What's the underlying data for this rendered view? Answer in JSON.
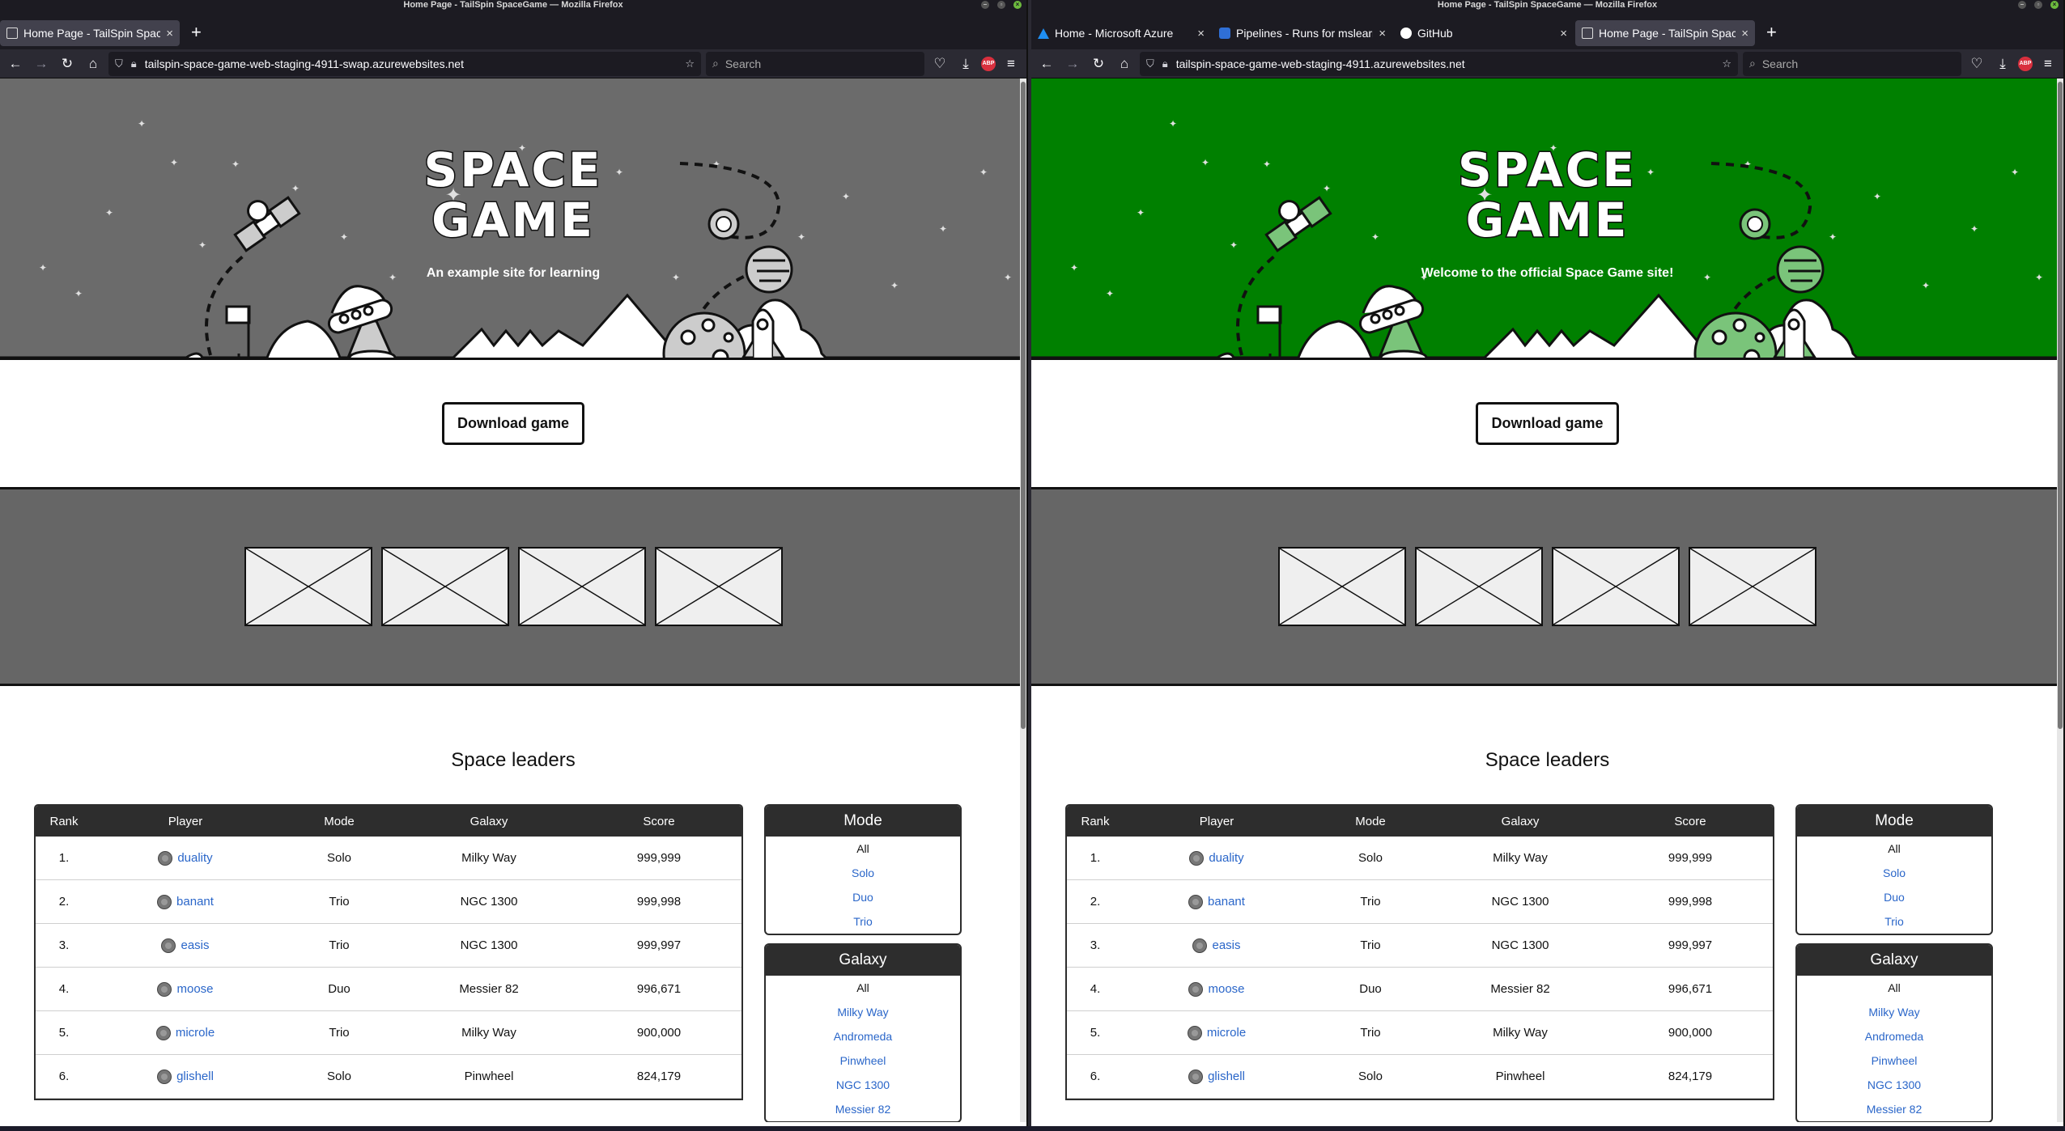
{
  "os": {
    "window_title": "Home Page - TailSpin SpaceGame — Mozilla Firefox"
  },
  "left": {
    "tabs": [
      {
        "label": "Home Page - TailSpin Space",
        "icon": "page-icon",
        "active": true
      }
    ],
    "url": "tailspin-space-game-web-staging-4911-swap.azurewebsites.net",
    "search_placeholder": "Search",
    "hero_color": "#6b6b6b",
    "hero_accent": "#cccccc",
    "subtitle": "An example site for learning"
  },
  "right": {
    "tabs": [
      {
        "label": "Home - Microsoft Azure",
        "icon": "azure-icon",
        "active": false
      },
      {
        "label": "Pipelines - Runs for mslearn",
        "icon": "pipelines-icon",
        "active": false
      },
      {
        "label": "GitHub",
        "icon": "github-icon",
        "active": false
      },
      {
        "label": "Home Page - TailSpin Space",
        "icon": "page-icon",
        "active": true
      }
    ],
    "url": "tailspin-space-game-web-staging-4911.azurewebsites.net",
    "search_placeholder": "Search",
    "hero_color": "#008000",
    "hero_accent": "#7ac47a",
    "subtitle": "Welcome to the official Space Game site!"
  },
  "site": {
    "title_line1": "SPACE",
    "title_line2": "GAME",
    "download_label": "Download game",
    "leaders_title": "Space leaders",
    "table_headers": [
      "Rank",
      "Player",
      "Mode",
      "Galaxy",
      "Score"
    ],
    "rows": [
      {
        "rank": "1.",
        "player": "duality",
        "mode": "Solo",
        "galaxy": "Milky Way",
        "score": "999,999"
      },
      {
        "rank": "2.",
        "player": "banant",
        "mode": "Trio",
        "galaxy": "NGC 1300",
        "score": "999,998"
      },
      {
        "rank": "3.",
        "player": "easis",
        "mode": "Trio",
        "galaxy": "NGC 1300",
        "score": "999,997"
      },
      {
        "rank": "4.",
        "player": "moose",
        "mode": "Duo",
        "galaxy": "Messier 82",
        "score": "996,671"
      },
      {
        "rank": "5.",
        "player": "microle",
        "mode": "Trio",
        "galaxy": "Milky Way",
        "score": "900,000"
      },
      {
        "rank": "6.",
        "player": "glishell",
        "mode": "Solo",
        "galaxy": "Pinwheel",
        "score": "824,179"
      }
    ],
    "mode_filter": {
      "title": "Mode",
      "items": [
        "All",
        "Solo",
        "Duo",
        "Trio"
      ]
    },
    "galaxy_filter": {
      "title": "Galaxy",
      "items": [
        "All",
        "Milky Way",
        "Andromeda",
        "Pinwheel",
        "NGC 1300",
        "Messier 82"
      ]
    }
  }
}
